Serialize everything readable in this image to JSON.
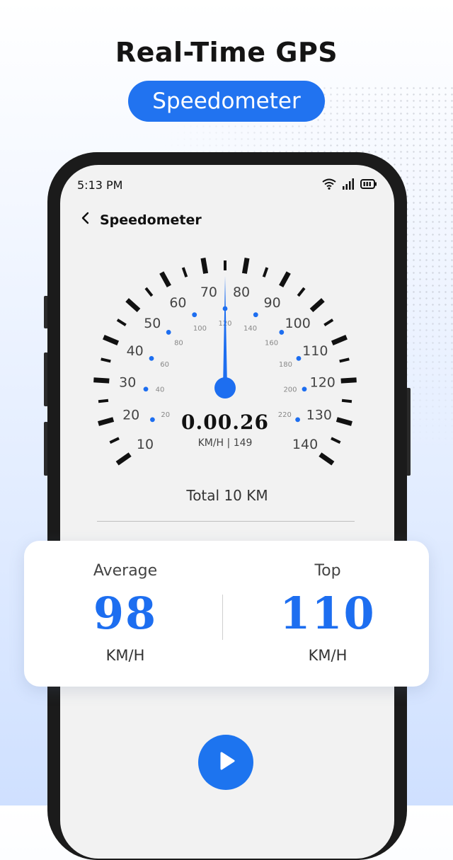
{
  "headline": "Real-Time GPS",
  "pill_label": "Speedometer",
  "status": {
    "time": "5:13 PM",
    "icons": [
      "wifi-icon",
      "signal-icon",
      "battery-icon"
    ]
  },
  "nav": {
    "back_icon": "chevron-left-icon",
    "title": "Speedometer"
  },
  "gauge": {
    "outer_labels": [
      "10",
      "20",
      "30",
      "40",
      "50",
      "60",
      "70",
      "80",
      "90",
      "100",
      "110",
      "120",
      "130",
      "140"
    ],
    "inner_labels": [
      "20",
      "40",
      "60",
      "80",
      "100",
      "120",
      "140",
      "160",
      "180",
      "200",
      "220"
    ],
    "needle_value_kmh": 75,
    "readout": "0.00.26",
    "unit_line": "KM/H  |  149",
    "accent": "#1d6ef0"
  },
  "total": "Total 10 KM",
  "stats": {
    "average": {
      "label": "Average",
      "value": "98",
      "unit": "KM/H"
    },
    "top": {
      "label": "Top",
      "value": "110",
      "unit": "KM/H"
    }
  },
  "play_icon": "play-icon"
}
